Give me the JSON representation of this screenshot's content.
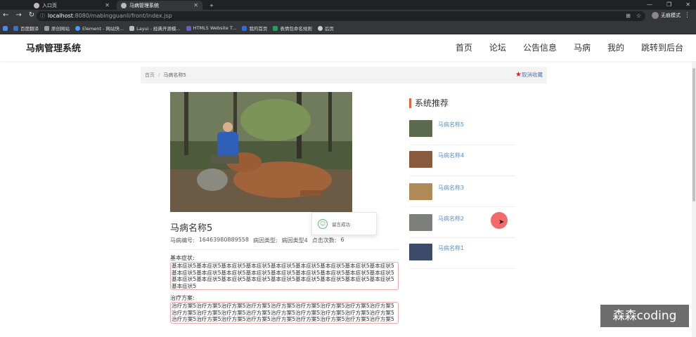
{
  "browser": {
    "tabs": [
      {
        "label": "入口页",
        "active": false
      },
      {
        "label": "马病管理系统",
        "active": true
      }
    ],
    "new_tab_icon": "plus-icon",
    "url_host": "localhost",
    "url_rest": ":8080/mabingguanli/front/index.jsp",
    "profile_label": "无痕模式",
    "bookmarks": [
      "百度翻译",
      "原创网站",
      "Element - 网站快...",
      "Layui - 经典开源模...",
      "HTML5 Website T...",
      "我的首页",
      "表情包命名规则",
      "后页"
    ]
  },
  "site": {
    "brand": "马病管理系统",
    "menu": [
      "首页",
      "论坛",
      "公告信息",
      "马病",
      "我的",
      "跳转到后台"
    ]
  },
  "breadcrumb": {
    "home": "首页",
    "separator": "/",
    "current": "马病名称5"
  },
  "favorite_label": "取消收藏",
  "detail": {
    "title": "马病名称5",
    "code_label": "马病编号:",
    "code_value": "16463980889558",
    "type_label": "病因类型:",
    "type_value": "病因类型4",
    "clicks_label": "点击次数:",
    "clicks_value": "6",
    "symptom_label": "基本症状:",
    "symptom_text": "基本症状5基本症状5基本症状5基本症状5基本症状5基本症状5基本症状5基本症状5基本症状5基本症状5基本症状5基本症状5基本症状5基本症状5基本症状5基本症状5基本症状5基本症状5基本症状5基本症状5基本症状5基本症状5基本症状5基本症状5基本症状5基本症状5基本症状5基本症状5",
    "treatment_label": "治疗方案:",
    "treatment_text": "治疗方案5治疗方案5治疗方案5治疗方案5治疗方案5治疗方案5治疗方案5治疗方案5治疗方案5治疗方案5治疗方案5治疗方案5治疗方案5治疗方案5治疗方案5治疗方案5治疗方案5治疗方案5治疗方案5治疗方案5治疗方案5治疗方案5治疗方案5治疗方案5治疗方案5治疗方案5治疗方案5"
  },
  "toast": {
    "message": "留言成功"
  },
  "sidebar": {
    "title": "系统推荐",
    "items": [
      {
        "name": "马病名称5",
        "color": "#5b6b4f"
      },
      {
        "name": "马病名称4",
        "color": "#8a5a3c"
      },
      {
        "name": "马病名称3",
        "color": "#b08b58"
      },
      {
        "name": "马病名称2",
        "color": "#7d7f7a"
      },
      {
        "name": "马病名称1",
        "color": "#3d4b6a"
      }
    ]
  },
  "watermark": "森森coding"
}
